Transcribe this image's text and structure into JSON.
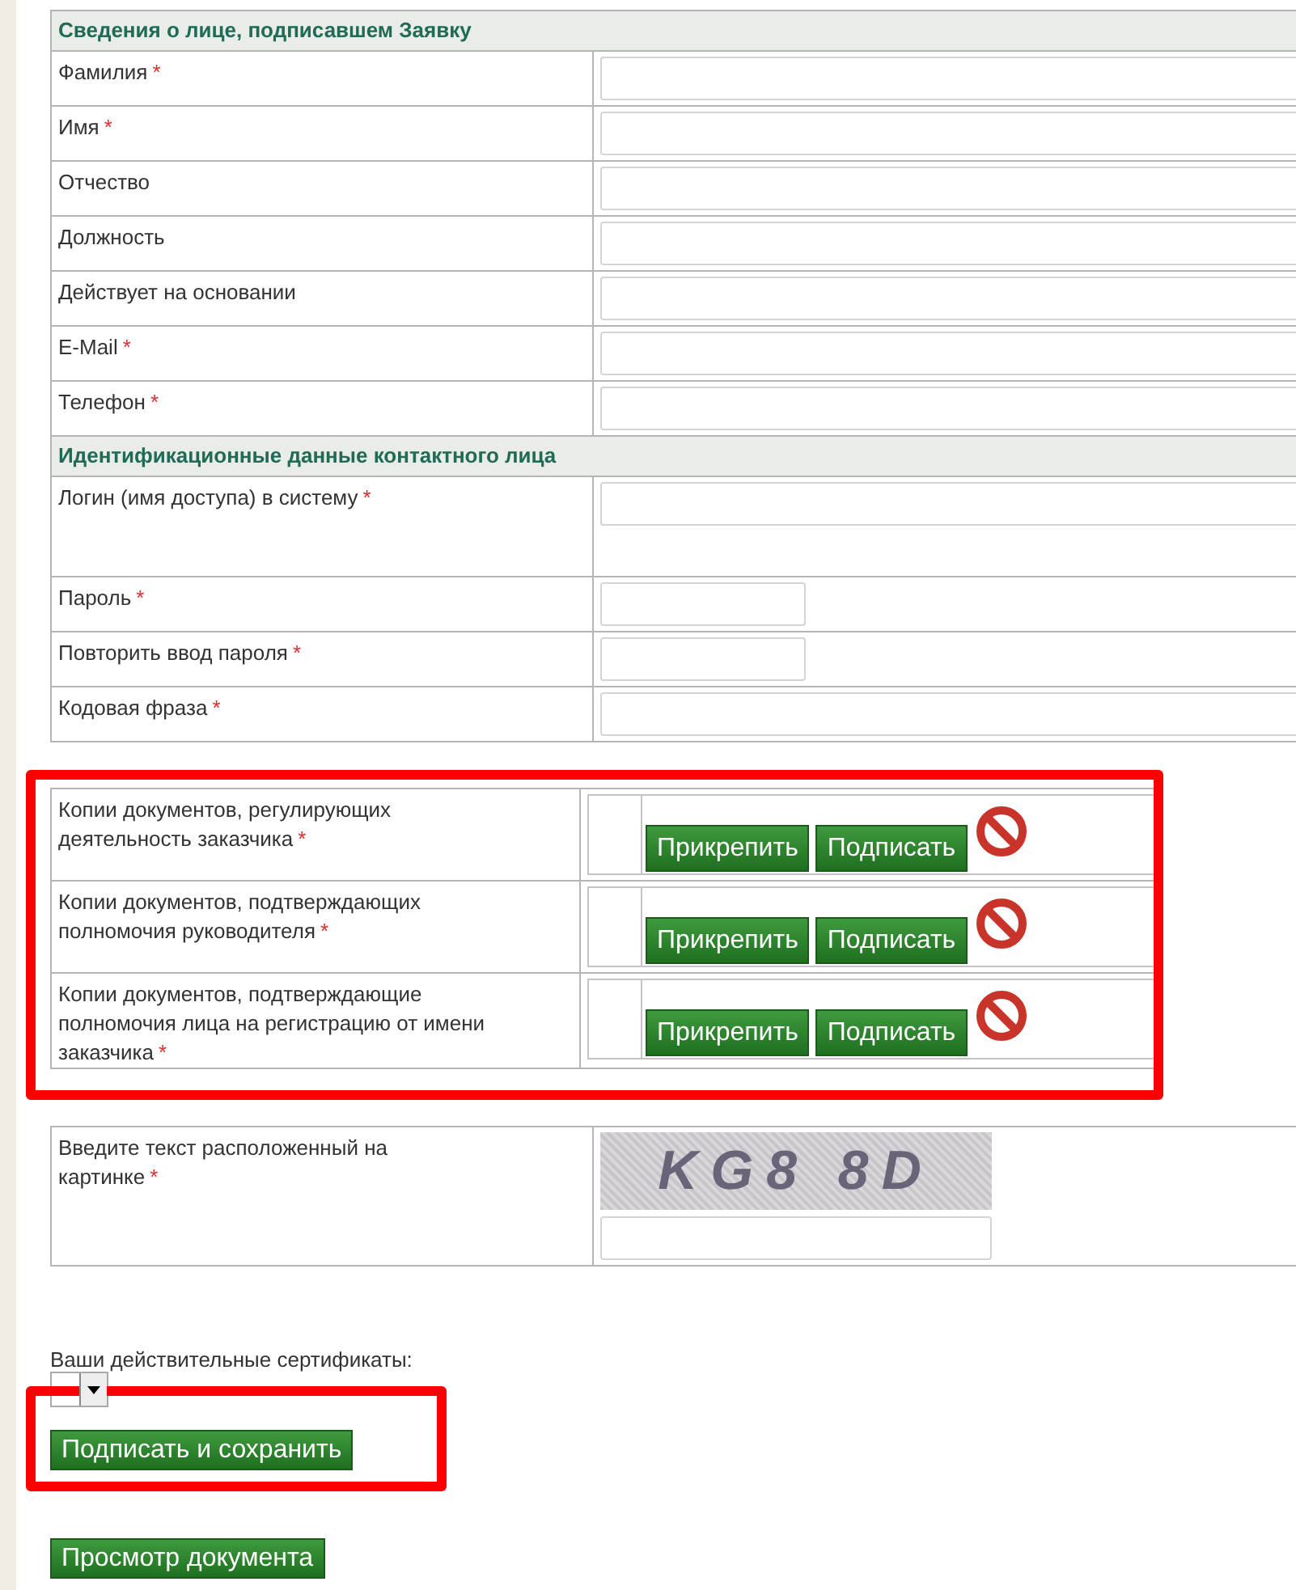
{
  "sections": [
    {
      "title": "Сведения о лице, подписавшем Заявку",
      "rows": [
        {
          "label": "Фамилия",
          "mark": "*",
          "kind": "wide"
        },
        {
          "label": "Имя",
          "mark": "*",
          "kind": "wide"
        },
        {
          "label": "Отчество",
          "kind": "wide"
        },
        {
          "label": "Должность",
          "kind": "wide"
        },
        {
          "label": "Действует на основании",
          "kind": "wide"
        },
        {
          "label": "E-Mail",
          "mark": "*",
          "kind": "wide"
        },
        {
          "label": "Телефон",
          "mark": "*",
          "kind": "wide"
        }
      ]
    },
    {
      "title": "Идентификационные данные контактного лица",
      "rows": [
        {
          "label": "Логин (имя доступа) в систему",
          "mark": "*",
          "kind": "tall"
        },
        {
          "label": "Пароль",
          "mark": "*",
          "kind": "short"
        },
        {
          "label": "Повторить ввод пароля",
          "mark": "*",
          "kind": "short"
        },
        {
          "label": "Кодовая фраза",
          "mark": "*",
          "kind": "wide"
        }
      ]
    }
  ],
  "documents": [
    {
      "label": "Копии документов, регулирующих деятельность заказчика",
      "mark": "*",
      "buttons": [
        "Прикрепить",
        "Подписать"
      ]
    },
    {
      "label": "Копии документов, подтверждающих полномочия руководителя",
      "mark": "*",
      "buttons": [
        "Прикрепить",
        "Подписать"
      ]
    },
    {
      "label": "Копии документов, подтверждающие полномочия лица на регистрацию от имени заказчика",
      "mark": "*",
      "buttons": [
        "Прикрепить",
        "Подписать"
      ]
    }
  ],
  "captcha": {
    "label": "Введите текст расположенный на картинке",
    "mark": "*",
    "text": "KG8 8D"
  },
  "certificates": {
    "label": "Ваши действительные сертификаты:"
  },
  "buttons": [
    {
      "label": "Подписать и сохранить",
      "highlighted": true
    },
    {
      "label": "Просмотр документа",
      "highlighted": false
    }
  ]
}
